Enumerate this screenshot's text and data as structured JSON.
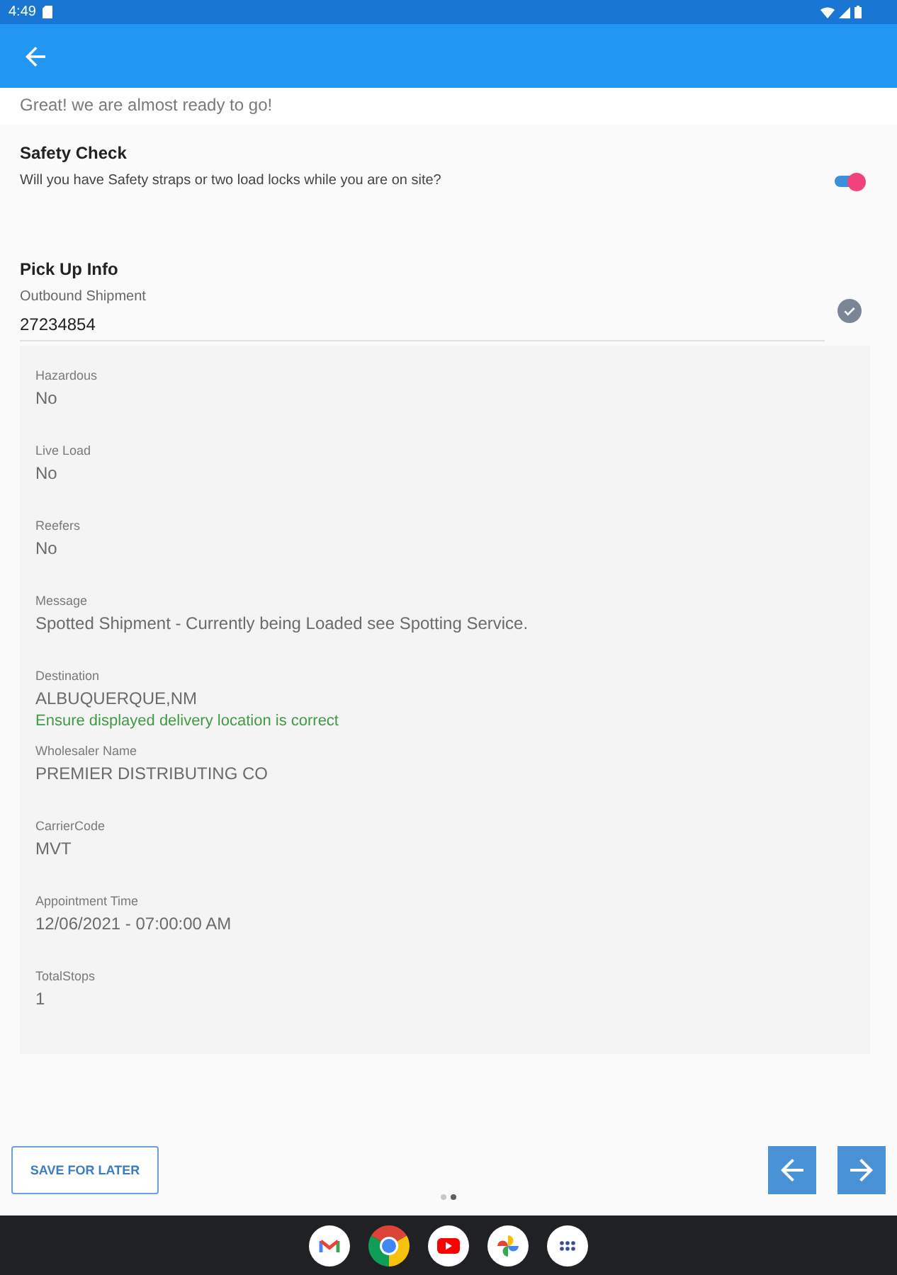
{
  "status_bar": {
    "time": "4:49"
  },
  "intro": "Great! we are almost ready to go!",
  "safety_check": {
    "title": "Safety Check",
    "question": "Will you have Safety straps or two load locks while you are on site?",
    "on": true
  },
  "pick_up_info": {
    "title": "Pick Up Info",
    "shipment": {
      "label": "Outbound Shipment",
      "value": "27234854",
      "verified": true
    },
    "details": [
      {
        "label": "Hazardous",
        "value": "No"
      },
      {
        "label": "Live Load",
        "value": "No"
      },
      {
        "label": "Reefers",
        "value": "No"
      },
      {
        "label": "Message",
        "value": "Spotted Shipment - Currently being Loaded see Spotting Service."
      },
      {
        "label": "Destination",
        "value": "ALBUQUERQUE,NM",
        "note": "Ensure displayed delivery location is correct"
      },
      {
        "label": "Wholesaler Name",
        "value": "PREMIER DISTRIBUTING CO"
      },
      {
        "label": "CarrierCode",
        "value": "MVT"
      },
      {
        "label": "Appointment Time",
        "value": "12/06/2021 - 07:00:00 AM"
      },
      {
        "label": "TotalStops",
        "value": "1"
      }
    ]
  },
  "footer": {
    "save_button": "SAVE FOR LATER",
    "page_dots": [
      {
        "selected": false
      },
      {
        "selected": true
      }
    ]
  }
}
